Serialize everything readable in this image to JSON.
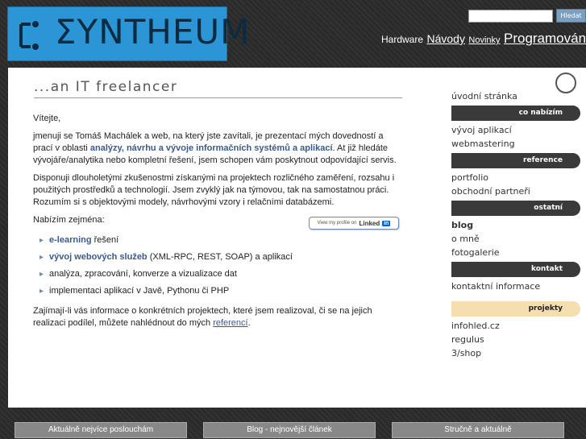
{
  "header": {
    "logo_text": "ΣYNTHEUM",
    "search": {
      "placeholder": "",
      "button_label": "Hledat"
    },
    "nav": [
      "Hardware",
      "Návody",
      "Novinky",
      "Programování"
    ]
  },
  "main": {
    "tagline": "...an IT freelancer",
    "greeting": "Vítejte,",
    "intro_1": "jmenuji se Tomáš Machálek a web, na který jste zavítali, je prezentací mých dovedností a prací v oblasti ",
    "intro_highlight": "analýzy, návrhu a vývoje informačních systémů a aplikací",
    "intro_2": ". At již hledáte vývojáře/analytika nebo kompletní řešení, jsem schopen vám poskytnout odpovídající servis.",
    "experience": "Disponuji dlouholetými zkušenostmi získanými na projektech rozličného zaměření, rozsahu i použitých prostředků a technologií. Jsem zvyklý jak na týmovou, tak na samostatnou práci. Rozumím si s objektovými modely, návrhovými vzory i relačními databázemi.",
    "offer_heading": "Nabízím zejména:",
    "services": [
      {
        "highlight": "e-learning",
        "rest": " řešení"
      },
      {
        "highlight": "vývoj webových služeb",
        "rest": " (XML-RPC, REST, SOAP) a aplikací"
      },
      {
        "highlight": "",
        "rest": "analýza, zpracování, konverze a vizualizace dat"
      },
      {
        "highlight": "",
        "rest": "implementaci aplikací v Javě, Pythonu či PHP"
      }
    ],
    "closing_1": "Zajímají-li vás informace o konkrétních projektech, které jsem realizoval, či se na jejich realizaci podílel, můžete nahlédnout do mých ",
    "closing_link": "referencí",
    "closing_2": ".",
    "linkedin": {
      "prefix": "View my profile on",
      "word": "Linked",
      "in": "in"
    }
  },
  "sidebar": {
    "top_link": "úvodní stránka",
    "sections": [
      {
        "heading": "co nabízím",
        "items": [
          "vývoj aplikací",
          "webmastering"
        ]
      },
      {
        "heading": "reference",
        "items": [
          "portfolio",
          "obchodní partneři"
        ]
      },
      {
        "heading": "ostatní",
        "items": [
          "blog",
          "o mně",
          "fotogalerie"
        ]
      },
      {
        "heading": "kontakt",
        "items": [
          "kontaktní informace"
        ]
      },
      {
        "heading": "projekty",
        "items": [
          "infohled.cz",
          "regulus",
          "3/shop"
        ]
      }
    ]
  },
  "footer": {
    "tabs": [
      "Aktuálně nejvíce poslouchám",
      "Blog - nejnovější článek",
      "Stručně a aktuálně"
    ]
  },
  "colors": {
    "accent": "#3b5a8c",
    "logo_bg": "#2b95d6",
    "projects_header": "#f5deb0"
  }
}
